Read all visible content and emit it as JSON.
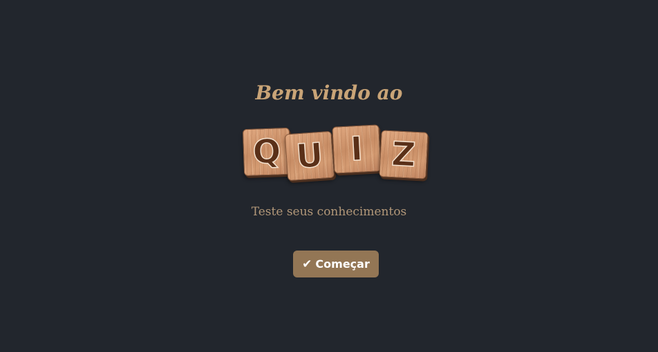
{
  "welcome": {
    "title": "Bem vindo ao"
  },
  "logo": {
    "letters": [
      "Q",
      "U",
      "I",
      "Z"
    ]
  },
  "subtitle": "Teste seus conhecimentos",
  "start_button": {
    "icon": "checkmark-icon",
    "icon_glyph": "✔",
    "label": "Começar"
  },
  "colors": {
    "background": "#22262d",
    "accent_text": "#c9a477",
    "button": "#937655",
    "tile_letter": "#5a3018"
  }
}
